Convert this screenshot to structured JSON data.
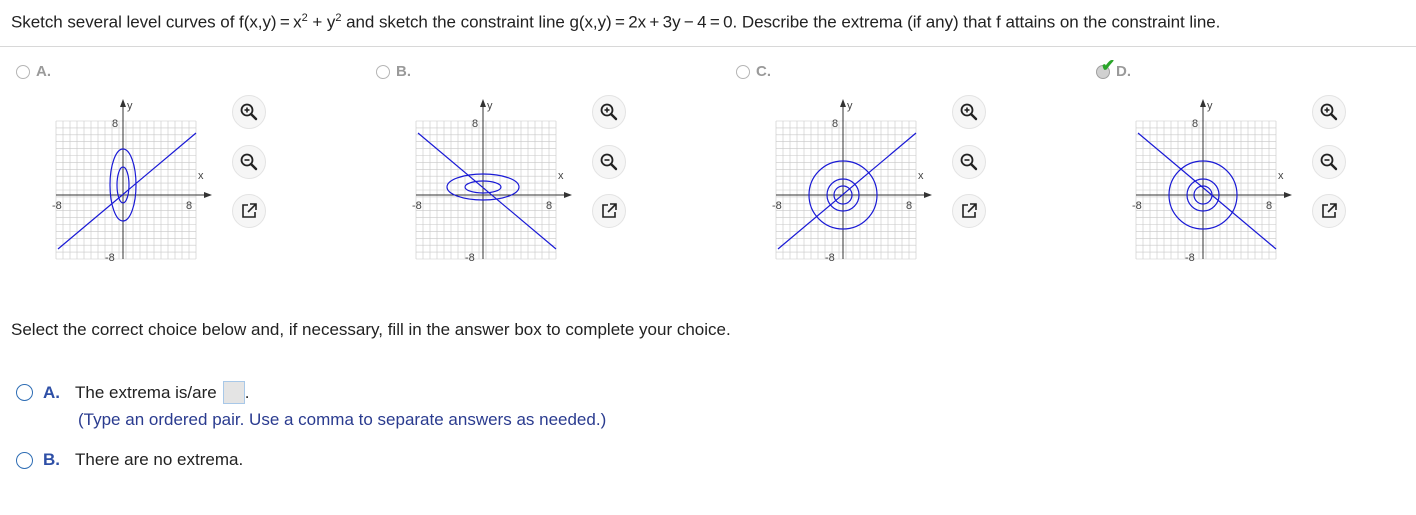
{
  "question": {
    "prefix": "Sketch several level curves of f(x,y) = x",
    "sup1": "2",
    "mid1": " + y",
    "sup2": "2",
    "suffix": " and sketch the constraint line g(x,y) = 2x + 3y − 4 = 0. Describe the extrema (if any) that f attains on the constraint line."
  },
  "graph_choices": [
    {
      "letter": "A.",
      "selected": false,
      "curves": "vertical ellipses",
      "line_slope": "positive"
    },
    {
      "letter": "B.",
      "selected": false,
      "curves": "horizontal ellipses",
      "line_slope": "negative"
    },
    {
      "letter": "C.",
      "selected": false,
      "curves": "circles",
      "line_slope": "positive"
    },
    {
      "letter": "D.",
      "selected": true,
      "curves": "circles",
      "line_slope": "negative"
    }
  ],
  "axis_labels": {
    "x": "x",
    "y": "y",
    "pos": "8",
    "neg": "-8"
  },
  "tools": {
    "zoom_in": "zoom-in-icon",
    "zoom_out": "zoom-out-icon",
    "popout": "external-link-icon"
  },
  "colors": {
    "curve": "#1a1ad6",
    "grid": "#c8c8c8",
    "accent": "#2e4fa6",
    "check": "#2aa52a"
  },
  "instruction": "Select the correct choice below and, if necessary, fill in the answer box to complete your choice.",
  "answers": {
    "a_letter": "A.",
    "a_text": "The extrema is/are",
    "a_period": ".",
    "a_hint": "(Type an ordered pair. Use a comma to separate answers as needed.)",
    "b_letter": "B.",
    "b_text": "There are no extrema."
  }
}
